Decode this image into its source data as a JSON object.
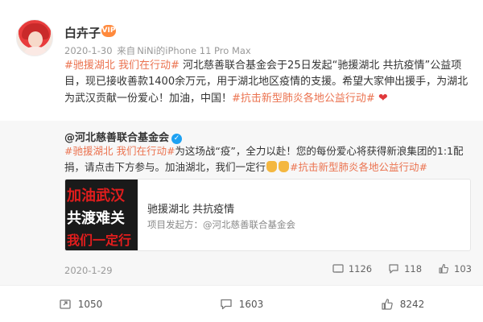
{
  "post": {
    "username": "白卉子",
    "badge": "VIP",
    "date": "2020-1-30",
    "source_prefix": "来自",
    "source": "NiNi的iPhone 11 Pro Max",
    "body": {
      "topic1": "#驰援湖北 我们在行动#",
      "text1": " 河北慈善联合基金会于25日发起“驰援湖北 共抗疫情”公益项目，现已接收善款1400余万元，用于湖北地区疫情的支援。希望大家伸出援手，为湖北为武汉贡献一份爱心！加油，中国！",
      "topic2": "#抗击新型肺炎各地公益行动#",
      "heart": "❤"
    }
  },
  "retweet": {
    "author": "@河北慈善联合基金会",
    "verified": "✓",
    "body": {
      "topic1": "#驰援湖北 我们在行动#",
      "text1": "为这场战“疫”，全力以赴！您的每份爱心将获得新浪集团的1:1配捐，请点击下方参与。加油湖北，我们一定行",
      "topic2": "#抗击新型肺炎各地公益行动#"
    },
    "card": {
      "thumb_line1": "加油武汉",
      "thumb_line2": "共渡难关",
      "thumb_line3": "我们一定行",
      "title": "驰援湖北 共抗疫情",
      "subtitle": "项目发起方：@河北慈善联合基金会"
    },
    "date": "2020-1-29",
    "stats": {
      "reposts": "1126",
      "comments": "118",
      "likes": "103"
    }
  },
  "actions": {
    "repost": "1050",
    "comment": "1603",
    "like": "8242"
  },
  "colors": {
    "topic": "#eb7350",
    "heart": "#e0393b",
    "card_bg": "#f7f7f7"
  }
}
